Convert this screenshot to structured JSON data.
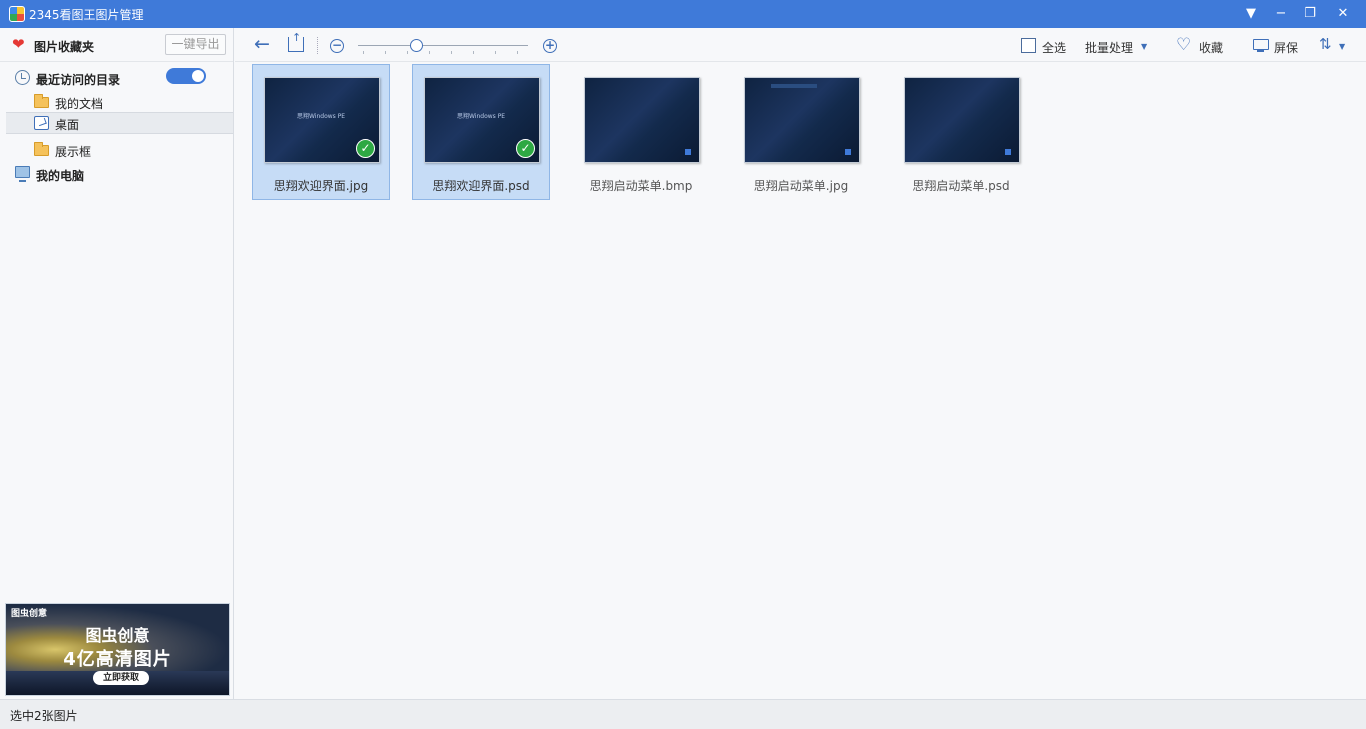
{
  "titlebar": {
    "title": "2345看图王图片管理"
  },
  "sidebar": {
    "favorites_label": "图片收藏夹",
    "export_label": "一键导出",
    "recent_label": "最近访问的目录",
    "items": [
      {
        "label": "我的文档"
      },
      {
        "label": "桌面"
      },
      {
        "label": "展示框"
      }
    ],
    "computer_label": "我的电脑"
  },
  "ad": {
    "logo": "图虫创意",
    "line1": "图虫创意",
    "line2": "4亿高清图片",
    "cta": "立即获取"
  },
  "toolbar": {
    "select_all": "全选",
    "batch": "批量处理",
    "favorite": "收藏",
    "screensaver": "屏保"
  },
  "files": [
    {
      "name": "思翔欢迎界面.jpg",
      "selected": true,
      "thumb_text": "思翔Windows PE"
    },
    {
      "name": "思翔欢迎界面.psd",
      "selected": true,
      "thumb_text": "思翔Windows PE"
    },
    {
      "name": "思翔启动菜单.bmp",
      "selected": false
    },
    {
      "name": "思翔启动菜单.jpg",
      "selected": false
    },
    {
      "name": "思翔启动菜单.psd",
      "selected": false
    }
  ],
  "status": {
    "text": "选中2张图片"
  },
  "colors": {
    "accent": "#3f7ad9",
    "selection": "#c6dcf6",
    "check": "#2ea843"
  },
  "zoom_level": 0.35
}
